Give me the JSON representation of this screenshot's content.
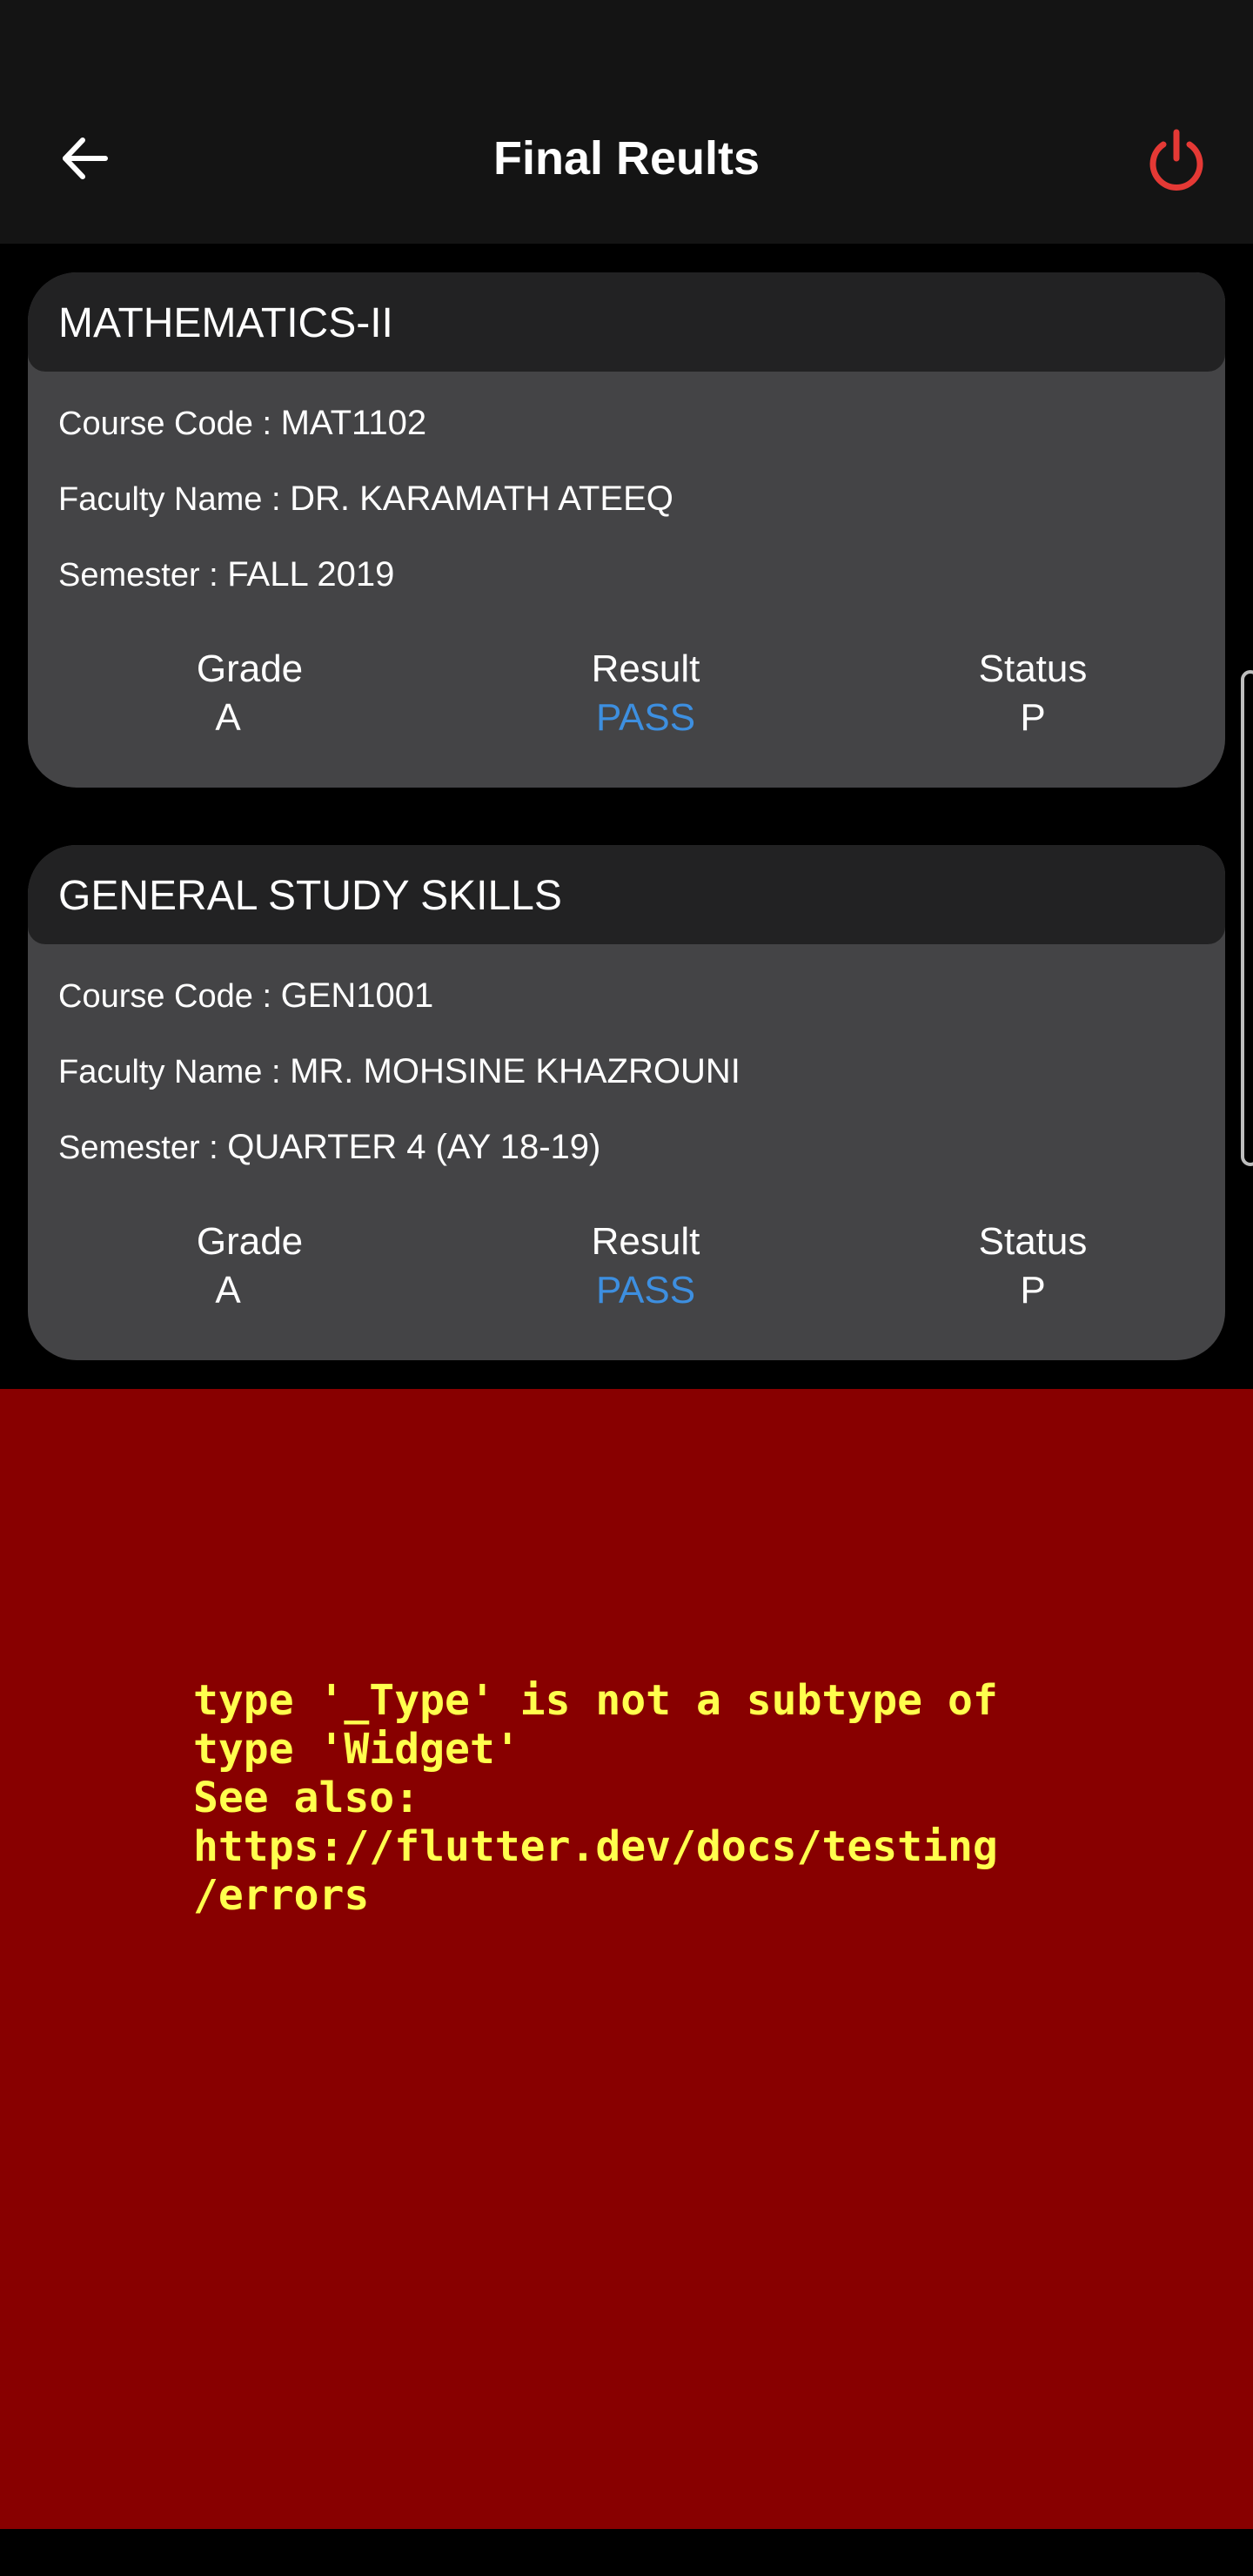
{
  "header": {
    "title": "Final Reults",
    "back_icon": "arrow-left-icon",
    "power_icon": "power-icon",
    "power_color": "#e53935"
  },
  "courses": [
    {
      "name": "MATHEMATICS-II",
      "course_code_label": "Course Code : ",
      "course_code": "MAT1102",
      "faculty_label": "Faculty Name : ",
      "faculty": "DR. KARAMATH ATEEQ",
      "semester_label": "Semester : ",
      "semester": "FALL 2019",
      "grade_label": "Grade",
      "grade": "A",
      "result_label": "Result",
      "result": "PASS",
      "status_label": "Status",
      "status": "P"
    },
    {
      "name": "GENERAL STUDY SKILLS",
      "course_code_label": "Course Code : ",
      "course_code": "GEN1001",
      "faculty_label": "Faculty Name : ",
      "faculty": "MR. MOHSINE KHAZROUNI",
      "semester_label": "Semester : ",
      "semester": "QUARTER 4 (AY 18-19)",
      "grade_label": "Grade",
      "grade": "A",
      "result_label": "Result",
      "result": "PASS",
      "status_label": "Status",
      "status": "P"
    }
  ],
  "error": {
    "message": "type '_Type' is not a subtype of\ntype 'Widget'\nSee also:\nhttps://flutter.dev/docs/testing\n/errors",
    "background": "#880000",
    "text_color": "#ffff4d"
  },
  "colors": {
    "pass": "#3d8fe0",
    "card": "#444446",
    "card_header": "#222223"
  }
}
